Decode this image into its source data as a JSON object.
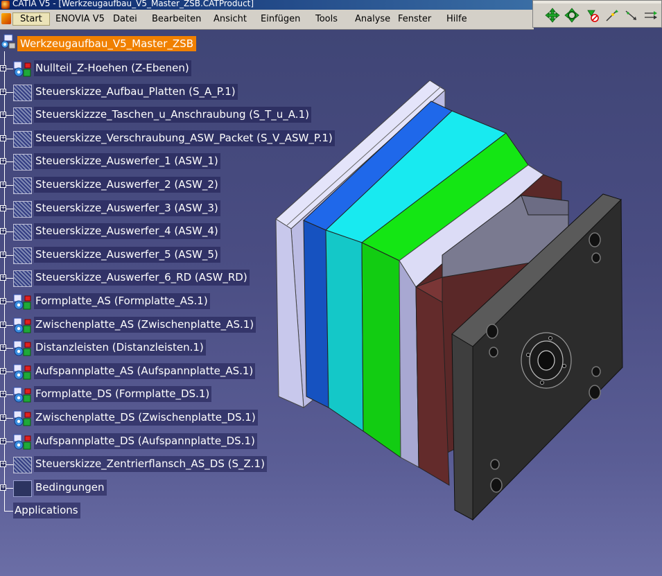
{
  "window": {
    "title": "CATIA V5 - [Werkzeugaufbau_V5_Master_ZSB.CATProduct]"
  },
  "menu": {
    "items": [
      "Start",
      "ENOVIA V5",
      "Datei",
      "Bearbeiten",
      "Ansicht",
      "Einfügen",
      "Tools",
      "Analyse",
      "Fenster",
      "Hilfe"
    ],
    "active": "Start"
  },
  "toolbar": {
    "buttons": [
      "pan-icon",
      "rotate-icon",
      "fly-mode-icon",
      "snap-icon",
      "direction-icon",
      "compass-icon"
    ]
  },
  "tree": {
    "root": "Werkzeugaufbau_V5_Master_ZSB",
    "nodes": [
      {
        "label": "Nullteil_Z-Hoehen (Z-Ebenen)",
        "icon": "part-icon"
      },
      {
        "label": "Steuerskizze_Aufbau_Platten (S_A_P.1)",
        "icon": "sketch-product-icon"
      },
      {
        "label": "Steuerskizzze_Taschen_u_Anschraubung (S_T_u_A.1)",
        "icon": "sketch-product-icon"
      },
      {
        "label": "Steuerskizze_Verschraubung_ASW_Packet (S_V_ASW_P.1)",
        "icon": "sketch-product-icon"
      },
      {
        "label": "Steuerskizze_Auswerfer_1 (ASW_1)",
        "icon": "sketch-product-icon"
      },
      {
        "label": "Steuerskizze_Auswerfer_2 (ASW_2)",
        "icon": "sketch-product-icon"
      },
      {
        "label": "Steuerskizze_Auswerfer_3 (ASW_3)",
        "icon": "sketch-product-icon"
      },
      {
        "label": "Steuerskizze_Auswerfer_4 (ASW_4)",
        "icon": "sketch-product-icon"
      },
      {
        "label": "Steuerskizze_Auswerfer_5 (ASW_5)",
        "icon": "sketch-product-icon"
      },
      {
        "label": "Steuerskizze_Auswerfer_6_RD (ASW_RD)",
        "icon": "sketch-product-icon"
      },
      {
        "label": "Formplatte_AS (Formplatte_AS.1)",
        "icon": "part-icon"
      },
      {
        "label": "Zwischenplatte_AS (Zwischenplatte_AS.1)",
        "icon": "part-icon"
      },
      {
        "label": "Distanzleisten (Distanzleisten.1)",
        "icon": "part-icon"
      },
      {
        "label": "Aufspannplatte_AS (Aufspannplatte_AS.1)",
        "icon": "part-icon"
      },
      {
        "label": "Formplatte_DS (Formplatte_DS.1)",
        "icon": "part-icon"
      },
      {
        "label": "Zwischenplatte_DS (Zwischenplatte_DS.1)",
        "icon": "part-icon"
      },
      {
        "label": "Aufspannplatte_DS (Aufspannplatte_DS.1)",
        "icon": "part-icon"
      },
      {
        "label": "Steuerskizze_Zentrierflansch_AS_DS (S_Z.1)",
        "icon": "sketch-product-icon"
      },
      {
        "label": "Bedingungen",
        "icon": "constraints-icon"
      }
    ],
    "applications": "Applications"
  },
  "colors": {
    "root_highlight": "#f08000",
    "plate_lavender": "#c8c8ec",
    "plate_blue": "#1e6ae0",
    "plate_cyan": "#16dcdc",
    "plate_green": "#18d818",
    "plate_maroon": "#6b2c2c",
    "plate_dark": "#2e2e2e"
  }
}
